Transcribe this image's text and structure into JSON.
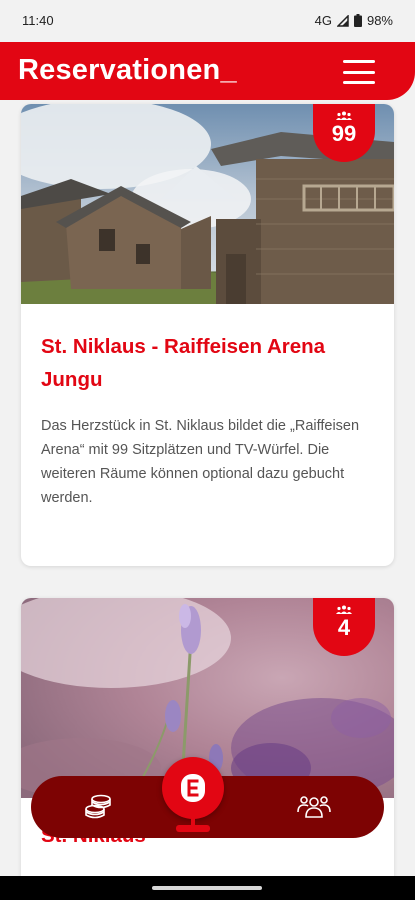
{
  "status_bar": {
    "time": "11:40",
    "network": "4G",
    "battery": "98%"
  },
  "header": {
    "title": "Reservationen_",
    "menu_icon": "hamburger-menu-icon",
    "background_color": "#e20613"
  },
  "rooms": [
    {
      "capacity": "99",
      "capacity_icon": "people-icon",
      "title": "St. Niklaus - Raiffeisen Arena Jungu",
      "description": "Das Herzstück in St. Niklaus bildet die „Raiffeisen Arena“ mit 99 Sitzplätzen und TV-Würfel. Die weiteren Räume können optional dazu gebucht werden.",
      "image": "alpine-wooden-huts-photo"
    },
    {
      "capacity": "4",
      "capacity_icon": "people-icon",
      "title": "St. Niklaus",
      "image": "lavender-flowers-photo"
    }
  ],
  "bottom_nav": {
    "left_icon": "coins-icon",
    "center_icon": "raiffeisen-logo-icon",
    "right_icon": "group-icon",
    "background_color": "#7d0303"
  }
}
